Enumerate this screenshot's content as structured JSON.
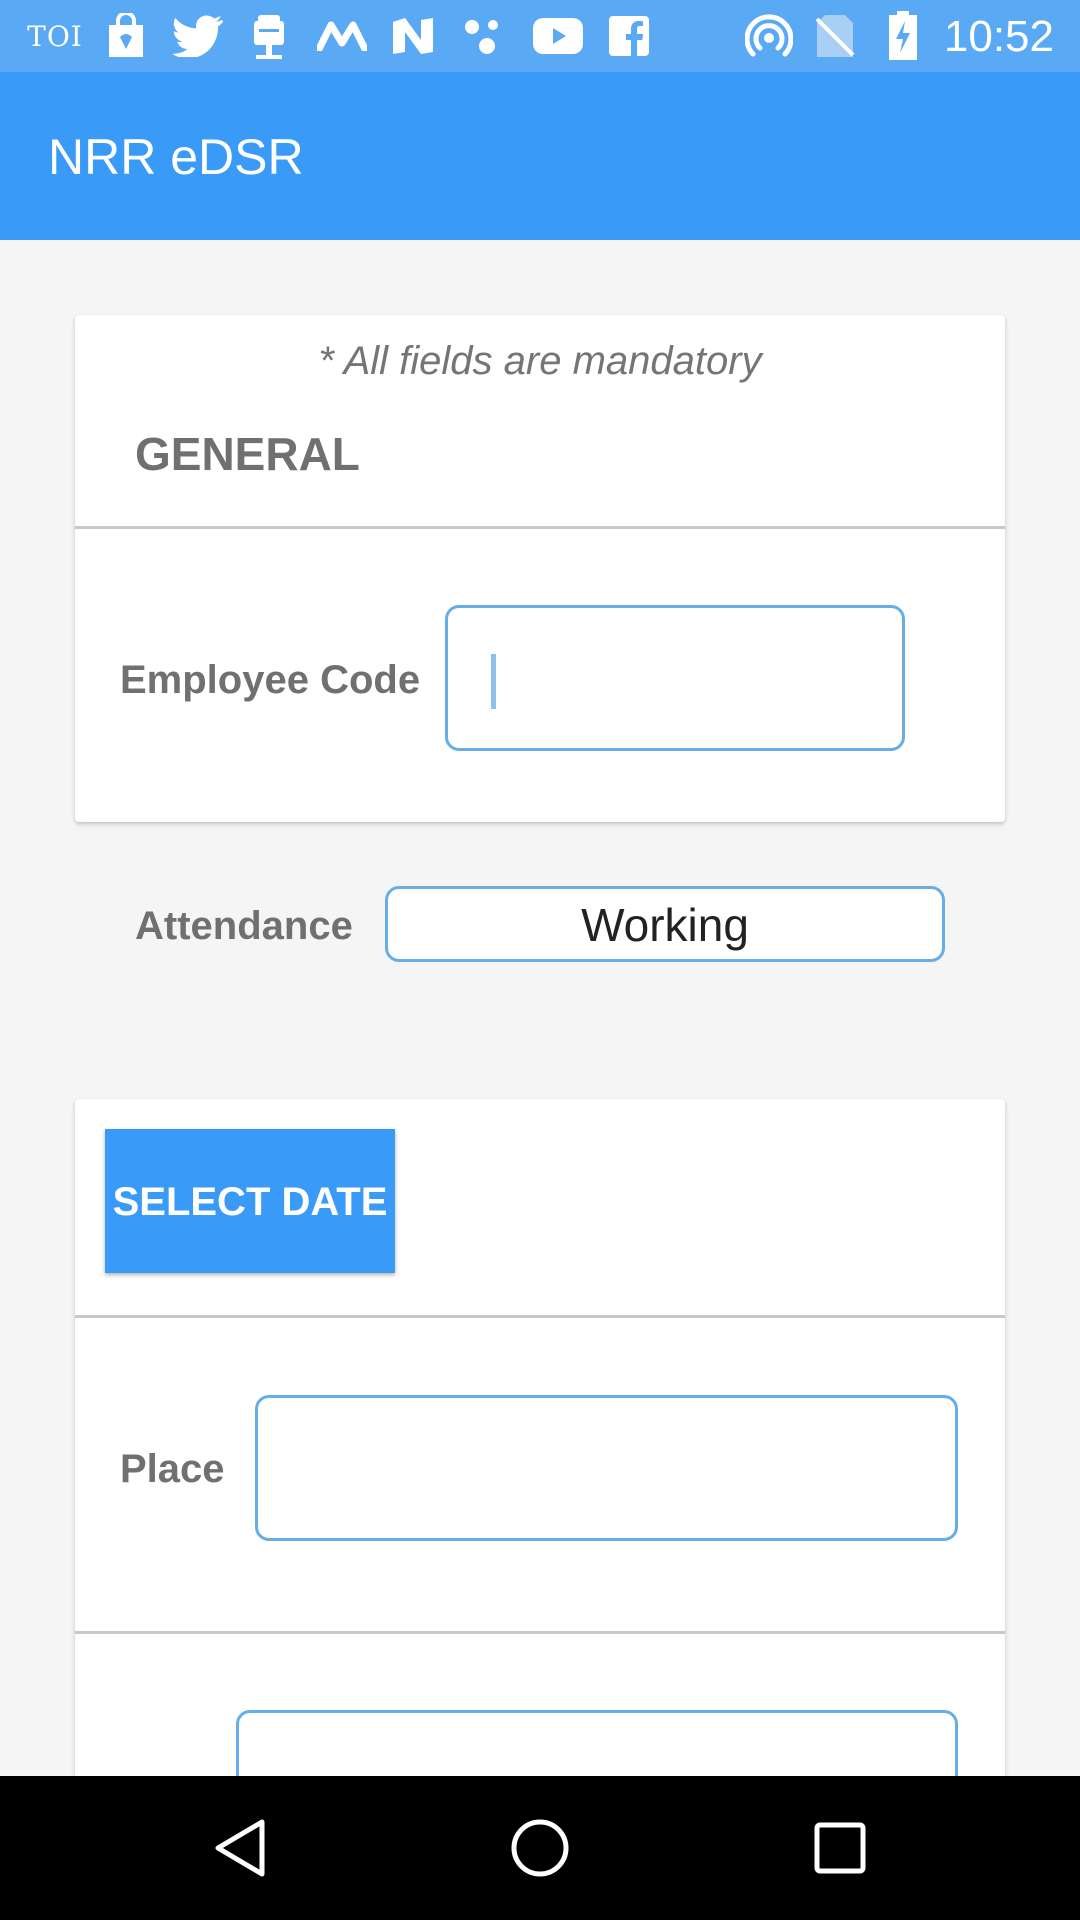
{
  "status_bar": {
    "time": "10:52",
    "toi_label": "TOI",
    "notification_icons": [
      "toi-icon",
      "shopping-bag-icon",
      "twitter-icon",
      "android-icon",
      "m-icon",
      "n-icon",
      "dots-icon",
      "youtube-icon",
      "facebook-icon"
    ],
    "system_icons": [
      "hotspot-icon",
      "no-sim-icon",
      "battery-charging-icon"
    ]
  },
  "app_bar": {
    "title": "NRR eDSR"
  },
  "general_card": {
    "mandatory_note": "* All fields are mandatory",
    "section_title": "GENERAL",
    "employee_code": {
      "label": "Employee Code",
      "value": ""
    },
    "attendance": {
      "label": "Attendance",
      "value": "Working"
    }
  },
  "date_card": {
    "select_date_label": "SELECT DATE",
    "place": {
      "label": "Place",
      "value": ""
    },
    "next_field": {
      "label": "",
      "value": ""
    }
  },
  "colors": {
    "status_bar": "#5aa9f5",
    "primary": "#3a9af7",
    "input_border": "#66aee8",
    "label_text": "#707070",
    "nav_bar": "#000000"
  },
  "nav_bar": {
    "icons": [
      "back-icon",
      "home-icon",
      "recents-icon"
    ]
  }
}
